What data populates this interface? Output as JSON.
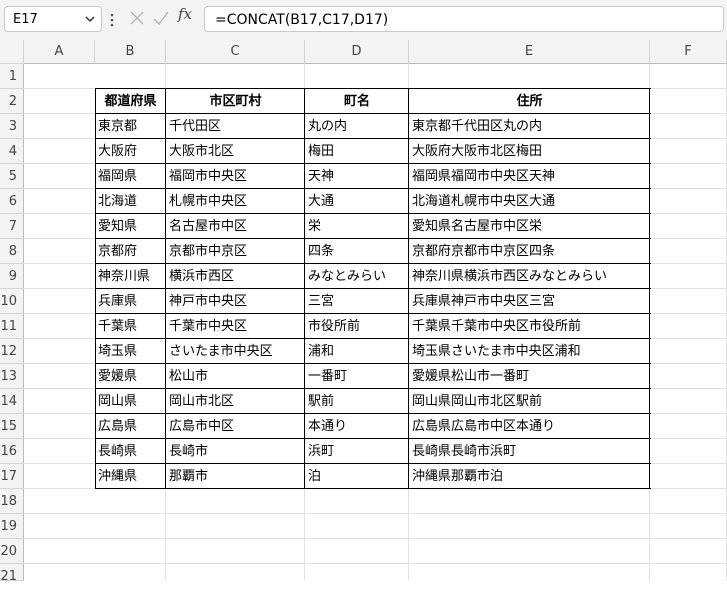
{
  "name_box": "E17",
  "formula_icon": "fx",
  "formula": "=CONCAT(B17,C17,D17)",
  "columns": [
    "A",
    "B",
    "C",
    "D",
    "E",
    "F"
  ],
  "row_numbers": [
    "1",
    "2",
    "3",
    "4",
    "5",
    "6",
    "7",
    "8",
    "9",
    "10",
    "11",
    "12",
    "13",
    "14",
    "15",
    "16",
    "17",
    "18",
    "19",
    "20",
    "21"
  ],
  "table": {
    "headers": [
      "都道府県",
      "市区町村",
      "町名",
      "住所"
    ],
    "rows": [
      [
        "東京都",
        "千代田区",
        "丸の内",
        "東京都千代田区丸の内"
      ],
      [
        "大阪府",
        "大阪市北区",
        "梅田",
        "大阪府大阪市北区梅田"
      ],
      [
        "福岡県",
        "福岡市中央区",
        "天神",
        "福岡県福岡市中央区天神"
      ],
      [
        "北海道",
        "札幌市中央区",
        "大通",
        "北海道札幌市中央区大通"
      ],
      [
        "愛知県",
        "名古屋市中区",
        "栄",
        "愛知県名古屋市中区栄"
      ],
      [
        "京都府",
        "京都市中京区",
        "四条",
        "京都府京都市中京区四条"
      ],
      [
        "神奈川県",
        "横浜市西区",
        "みなとみらい",
        "神奈川県横浜市西区みなとみらい"
      ],
      [
        "兵庫県",
        "神戸市中央区",
        "三宮",
        "兵庫県神戸市中央区三宮"
      ],
      [
        "千葉県",
        "千葉市中央区",
        "市役所前",
        "千葉県千葉市中央区市役所前"
      ],
      [
        "埼玉県",
        "さいたま市中央区",
        "浦和",
        "埼玉県さいたま市中央区浦和"
      ],
      [
        "愛媛県",
        "松山市",
        "一番町",
        "愛媛県松山市一番町"
      ],
      [
        "岡山県",
        "岡山市北区",
        "駅前",
        "岡山県岡山市北区駅前"
      ],
      [
        "広島県",
        "広島市中区",
        "本通り",
        "広島県広島市中区本通り"
      ],
      [
        "長崎県",
        "長崎市",
        "浜町",
        "長崎県長崎市浜町"
      ],
      [
        "沖縄県",
        "那覇市",
        "泊",
        "沖縄県那覇市泊"
      ]
    ]
  }
}
